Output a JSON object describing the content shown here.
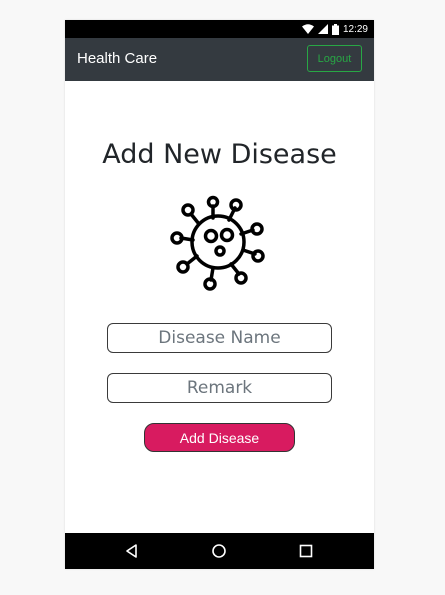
{
  "status_bar": {
    "time": "12:29",
    "icons": [
      "wifi-icon",
      "signal-icon",
      "battery-icon"
    ]
  },
  "app_bar": {
    "title": "Health Care",
    "logout_label": "Logout"
  },
  "page": {
    "title": "Add New Disease",
    "illustration": "virus-icon"
  },
  "form": {
    "disease_name": {
      "value": "",
      "placeholder": "Disease Name"
    },
    "remark": {
      "value": "",
      "placeholder": "Remark"
    },
    "submit_label": "Add Disease"
  },
  "nav_bar": {
    "icons": [
      "back-icon",
      "home-icon",
      "recents-icon"
    ]
  },
  "colors": {
    "app_bar": "#343a40",
    "logout_accent": "#28a745",
    "primary_button": "#d81b60",
    "title_text": "#212529"
  }
}
